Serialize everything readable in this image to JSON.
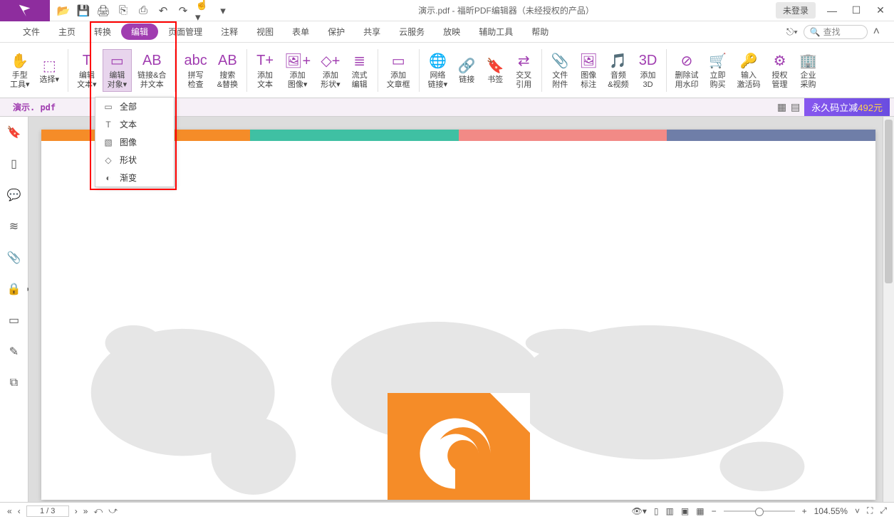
{
  "titlebar": {
    "title": "演示.pdf - 福昕PDF编辑器（未经授权的产品）",
    "login": "未登录"
  },
  "menu": {
    "items": [
      "文件",
      "主页",
      "转换",
      "编辑",
      "页面管理",
      "注释",
      "视图",
      "表单",
      "保护",
      "共享",
      "云服务",
      "放映",
      "辅助工具",
      "帮助"
    ],
    "active_index": 3,
    "search_placeholder": "查找"
  },
  "ribbon": [
    {
      "label1": "手型",
      "label2": "工具",
      "dd": true
    },
    {
      "label1": "选择",
      "dd": true
    },
    {
      "label1": "编辑",
      "label2": "文本",
      "dd": true
    },
    {
      "label1": "编辑",
      "label2": "对象",
      "dd": true,
      "active": true
    },
    {
      "label1": "链接&合",
      "label2": "并文本"
    },
    {
      "label1": "拼写",
      "label2": "检查"
    },
    {
      "label1": "搜索",
      "label2": "&替换"
    },
    {
      "label1": "添加",
      "label2": "文本"
    },
    {
      "label1": "添加",
      "label2": "图像",
      "dd": true
    },
    {
      "label1": "添加",
      "label2": "形状",
      "dd": true
    },
    {
      "label1": "流式",
      "label2": "编辑"
    },
    {
      "label1": "添加",
      "label2": "文章框"
    },
    {
      "label1": "网络",
      "label2": "链接",
      "dd": true
    },
    {
      "label1": "链接"
    },
    {
      "label1": "书签"
    },
    {
      "label1": "交叉",
      "label2": "引用"
    },
    {
      "label1": "文件",
      "label2": "附件"
    },
    {
      "label1": "图像",
      "label2": "标注"
    },
    {
      "label1": "音频",
      "label2": "&视频"
    },
    {
      "label1": "添加",
      "label2": "3D"
    },
    {
      "label1": "删除试",
      "label2": "用水印"
    },
    {
      "label1": "立即",
      "label2": "购买"
    },
    {
      "label1": "输入",
      "label2": "激活码"
    },
    {
      "label1": "授权",
      "label2": "管理"
    },
    {
      "label1": "企业",
      "label2": "采购"
    }
  ],
  "dropdown": {
    "items": [
      "全部",
      "文本",
      "图像",
      "形状",
      "渐变"
    ]
  },
  "tab": {
    "filename": "演示. pdf",
    "promo_prefix": "永久码立减",
    "promo_amount": "492元"
  },
  "left_panel_icons": [
    "bookmark",
    "page-thumb",
    "comment",
    "layers",
    "attachment",
    "security",
    "signature",
    "stamp",
    "compare"
  ],
  "status": {
    "page": "1 / 3",
    "zoom": "104.55%"
  }
}
